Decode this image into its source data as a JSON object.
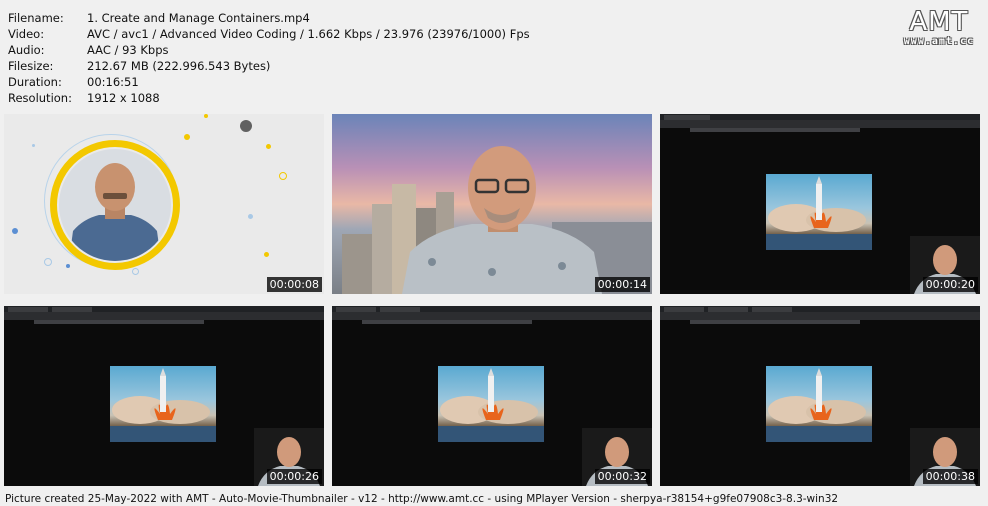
{
  "metadata": {
    "rows": [
      {
        "label": "Filename:",
        "value": "1. Create and Manage Containers.mp4"
      },
      {
        "label": "Video:",
        "value": "AVC / avc1 / Advanced Video Coding / 1.662 Kbps / 23.976 (23976/1000) Fps"
      },
      {
        "label": "Audio:",
        "value": "AAC / 93 Kbps"
      },
      {
        "label": "Filesize:",
        "value": "212.67 MB (222.996.543 Bytes)"
      },
      {
        "label": "Duration:",
        "value": "00:16:51"
      },
      {
        "label": "Resolution:",
        "value": "1912 x 1088"
      }
    ]
  },
  "logo": {
    "big": "AMT",
    "small": "www.amt.cc"
  },
  "thumbnails": [
    {
      "timestamp": "00:00:08"
    },
    {
      "timestamp": "00:00:14"
    },
    {
      "timestamp": "00:00:20"
    },
    {
      "timestamp": "00:00:26"
    },
    {
      "timestamp": "00:00:32"
    },
    {
      "timestamp": "00:00:38"
    }
  ],
  "footer": {
    "text": "Picture created 25-May-2022 with AMT - Auto-Movie-Thumbnailer - v12 - http://www.amt.cc - using MPlayer Version - sherpya-r38154+g9fe07908c3-8.3-win32"
  }
}
